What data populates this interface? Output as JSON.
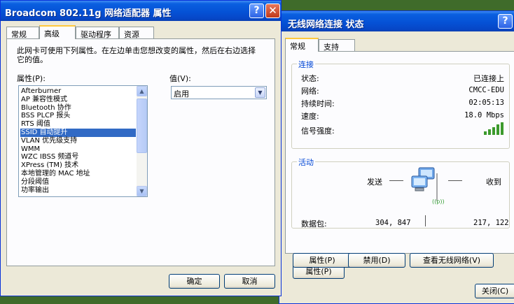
{
  "left_window": {
    "title": "Broadcom 802.11g 网络适配器 属性",
    "help_button": "?",
    "close_button": "✕",
    "tabs": [
      "常规",
      "高级",
      "驱动程序",
      "资源"
    ],
    "description": "此网卡可使用下列属性。在左边单击您想改变的属性，然后在右边选择它的值。",
    "property_label": "属性(P):",
    "value_label": "值(V):",
    "properties": [
      "Afterburner",
      "AP 兼容性模式",
      "Bluetooth 协作",
      "BSS PLCP 报头",
      "RTS 阈值",
      "SSID 自动提升",
      "VLAN 优先级支持",
      "WMM",
      "WZC IBSS 频道号",
      "XPress (TM) 技术",
      "本地管理的 MAC 地址",
      "分段阈值",
      "功率输出"
    ],
    "selected_property_index": 5,
    "value_selected": "启用",
    "ok_button": "确定",
    "cancel_button": "取消"
  },
  "right_window": {
    "title": "无线网络连接 状态",
    "help_button": "?",
    "tabs": [
      "常规",
      "支持"
    ],
    "connection_group": "连接",
    "status_label": "状态:",
    "status_value": "已连接上",
    "network_label": "网络:",
    "network_value": "CMCC-EDU",
    "duration_label": "持续时间:",
    "duration_value": "02:05:13",
    "speed_label": "速度:",
    "speed_value": "18.0 Mbps",
    "signal_label": "信号强度:",
    "signal_level": 5,
    "activity_group": "活动",
    "sent_label": "发送",
    "received_label": "收到",
    "packets_label": "数据包:",
    "packets_sent": "304, 847",
    "packets_received": "217, 122",
    "wireless_badge": "((p))",
    "properties_button": "属性(P)",
    "disable_button": "禁用(D)",
    "view_networks_button": "查看无线网络(V)",
    "close_button": "关闭(C)"
  },
  "colors": {
    "title_blue": "#0552d6",
    "window_bg": "#ece9d8",
    "selection": "#316ac5",
    "group_label": "#0046d5",
    "signal_green": "#3c9a2c"
  }
}
